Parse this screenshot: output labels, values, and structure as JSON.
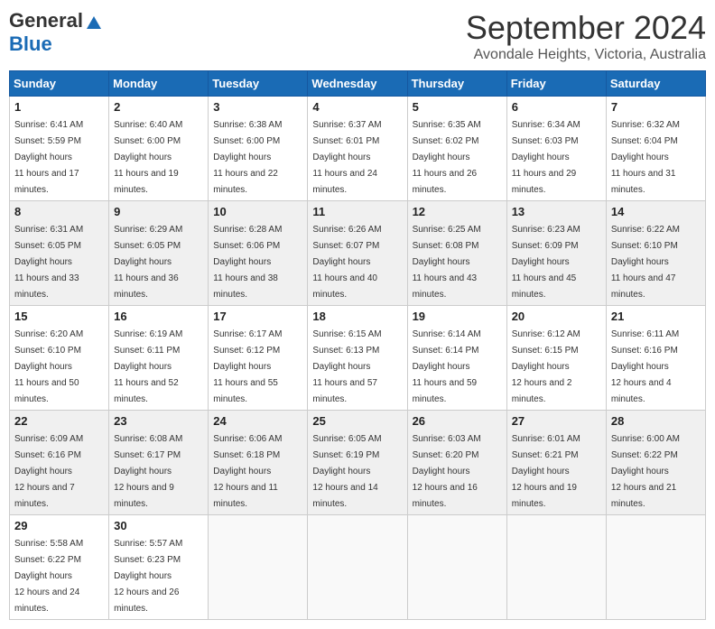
{
  "header": {
    "logo_general": "General",
    "logo_blue": "Blue",
    "month_title": "September 2024",
    "location": "Avondale Heights, Victoria, Australia"
  },
  "weekdays": [
    "Sunday",
    "Monday",
    "Tuesday",
    "Wednesday",
    "Thursday",
    "Friday",
    "Saturday"
  ],
  "weeks": [
    [
      {
        "day": 1,
        "sunrise": "6:41 AM",
        "sunset": "5:59 PM",
        "daylight": "11 hours and 17 minutes."
      },
      {
        "day": 2,
        "sunrise": "6:40 AM",
        "sunset": "6:00 PM",
        "daylight": "11 hours and 19 minutes."
      },
      {
        "day": 3,
        "sunrise": "6:38 AM",
        "sunset": "6:00 PM",
        "daylight": "11 hours and 22 minutes."
      },
      {
        "day": 4,
        "sunrise": "6:37 AM",
        "sunset": "6:01 PM",
        "daylight": "11 hours and 24 minutes."
      },
      {
        "day": 5,
        "sunrise": "6:35 AM",
        "sunset": "6:02 PM",
        "daylight": "11 hours and 26 minutes."
      },
      {
        "day": 6,
        "sunrise": "6:34 AM",
        "sunset": "6:03 PM",
        "daylight": "11 hours and 29 minutes."
      },
      {
        "day": 7,
        "sunrise": "6:32 AM",
        "sunset": "6:04 PM",
        "daylight": "11 hours and 31 minutes."
      }
    ],
    [
      {
        "day": 8,
        "sunrise": "6:31 AM",
        "sunset": "6:05 PM",
        "daylight": "11 hours and 33 minutes."
      },
      {
        "day": 9,
        "sunrise": "6:29 AM",
        "sunset": "6:05 PM",
        "daylight": "11 hours and 36 minutes."
      },
      {
        "day": 10,
        "sunrise": "6:28 AM",
        "sunset": "6:06 PM",
        "daylight": "11 hours and 38 minutes."
      },
      {
        "day": 11,
        "sunrise": "6:26 AM",
        "sunset": "6:07 PM",
        "daylight": "11 hours and 40 minutes."
      },
      {
        "day": 12,
        "sunrise": "6:25 AM",
        "sunset": "6:08 PM",
        "daylight": "11 hours and 43 minutes."
      },
      {
        "day": 13,
        "sunrise": "6:23 AM",
        "sunset": "6:09 PM",
        "daylight": "11 hours and 45 minutes."
      },
      {
        "day": 14,
        "sunrise": "6:22 AM",
        "sunset": "6:10 PM",
        "daylight": "11 hours and 47 minutes."
      }
    ],
    [
      {
        "day": 15,
        "sunrise": "6:20 AM",
        "sunset": "6:10 PM",
        "daylight": "11 hours and 50 minutes."
      },
      {
        "day": 16,
        "sunrise": "6:19 AM",
        "sunset": "6:11 PM",
        "daylight": "11 hours and 52 minutes."
      },
      {
        "day": 17,
        "sunrise": "6:17 AM",
        "sunset": "6:12 PM",
        "daylight": "11 hours and 55 minutes."
      },
      {
        "day": 18,
        "sunrise": "6:15 AM",
        "sunset": "6:13 PM",
        "daylight": "11 hours and 57 minutes."
      },
      {
        "day": 19,
        "sunrise": "6:14 AM",
        "sunset": "6:14 PM",
        "daylight": "11 hours and 59 minutes."
      },
      {
        "day": 20,
        "sunrise": "6:12 AM",
        "sunset": "6:15 PM",
        "daylight": "12 hours and 2 minutes."
      },
      {
        "day": 21,
        "sunrise": "6:11 AM",
        "sunset": "6:16 PM",
        "daylight": "12 hours and 4 minutes."
      }
    ],
    [
      {
        "day": 22,
        "sunrise": "6:09 AM",
        "sunset": "6:16 PM",
        "daylight": "12 hours and 7 minutes."
      },
      {
        "day": 23,
        "sunrise": "6:08 AM",
        "sunset": "6:17 PM",
        "daylight": "12 hours and 9 minutes."
      },
      {
        "day": 24,
        "sunrise": "6:06 AM",
        "sunset": "6:18 PM",
        "daylight": "12 hours and 11 minutes."
      },
      {
        "day": 25,
        "sunrise": "6:05 AM",
        "sunset": "6:19 PM",
        "daylight": "12 hours and 14 minutes."
      },
      {
        "day": 26,
        "sunrise": "6:03 AM",
        "sunset": "6:20 PM",
        "daylight": "12 hours and 16 minutes."
      },
      {
        "day": 27,
        "sunrise": "6:01 AM",
        "sunset": "6:21 PM",
        "daylight": "12 hours and 19 minutes."
      },
      {
        "day": 28,
        "sunrise": "6:00 AM",
        "sunset": "6:22 PM",
        "daylight": "12 hours and 21 minutes."
      }
    ],
    [
      {
        "day": 29,
        "sunrise": "5:58 AM",
        "sunset": "6:22 PM",
        "daylight": "12 hours and 24 minutes."
      },
      {
        "day": 30,
        "sunrise": "5:57 AM",
        "sunset": "6:23 PM",
        "daylight": "12 hours and 26 minutes."
      },
      null,
      null,
      null,
      null,
      null
    ]
  ]
}
